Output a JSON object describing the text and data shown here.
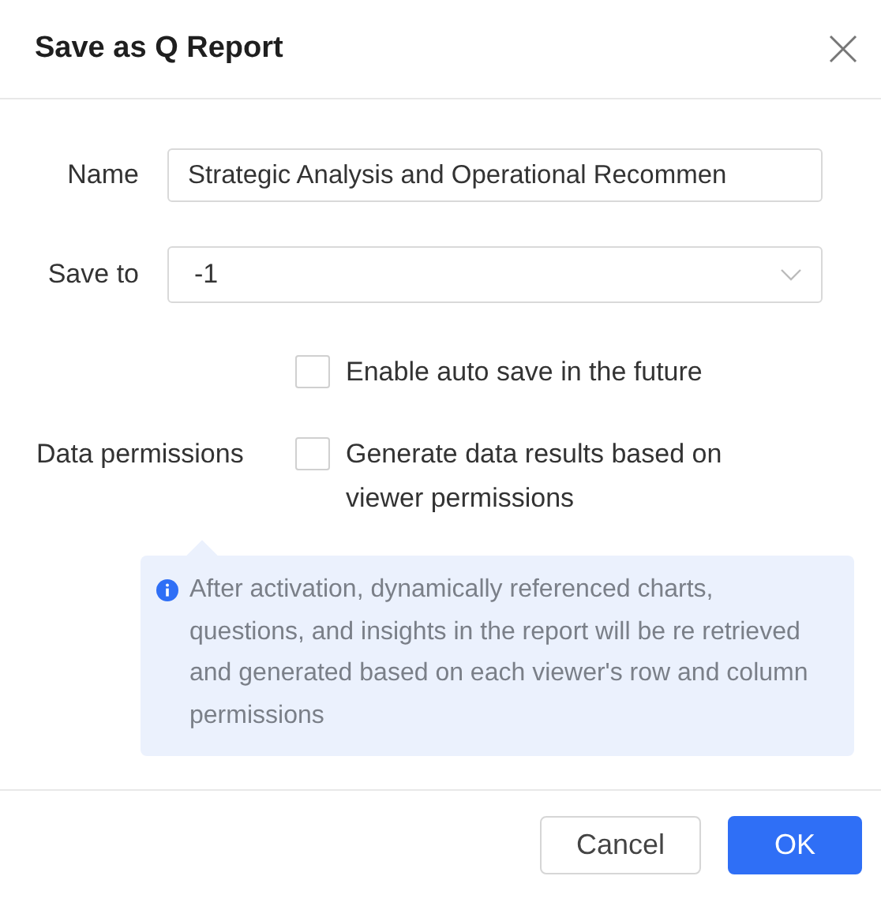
{
  "dialog": {
    "title": "Save as Q Report"
  },
  "name_field": {
    "label": "Name",
    "value": "Strategic Analysis and Operational Recommen"
  },
  "save_to_field": {
    "label": "Save to",
    "value": "-1"
  },
  "auto_save": {
    "label": "Enable auto save in the future",
    "checked": false
  },
  "data_permissions": {
    "label": "Data permissions",
    "option": "Generate data results based on viewer permissions",
    "checked": false
  },
  "info": "After activation, dynamically referenced charts, questions, and insights in the report will be re retrieved and generated based on each viewer's row and column permissions",
  "buttons": [
    {
      "label": "Cancel",
      "kind": "secondary"
    },
    {
      "label": "OK",
      "kind": "primary"
    }
  ]
}
